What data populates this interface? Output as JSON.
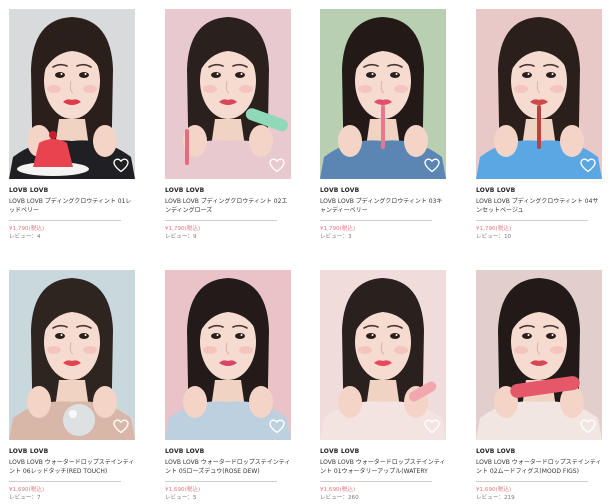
{
  "products": [
    {
      "brand": "LOVB LOVB",
      "name": "LOVB LOVB プディングクロウティント 01レッドベリー",
      "price": "¥1,790(税込)",
      "reviews": "レビュー：4",
      "bg": "#d9dadc",
      "lip": "#e03a4a",
      "hair": "#2b1f1c",
      "top": "#1f1f24",
      "prop": "jelly",
      "accent": "#e8434f"
    },
    {
      "brand": "LOVB LOVB",
      "name": "LOVB LOVB プディングクロウティント 02エンディングローズ",
      "price": "¥1,790(税込)",
      "reviews": "レビュー：9",
      "bg": "#e7c9cf",
      "lip": "#d8475c",
      "hair": "#2a201d",
      "top": "#e7c9cf",
      "prop": "tube-mint",
      "accent": "#8fd8b8"
    },
    {
      "brand": "LOVB LOVB",
      "name": "LOVB LOVB プディングクロウティント 03キャンディーベリー",
      "price": "¥1,790(税込)",
      "reviews": "レビュー：3",
      "bg": "#b9cfb1",
      "lip": "#e0506a",
      "hair": "#231a18",
      "top": "#5b86b4",
      "prop": "wand",
      "accent": "#e47a8d"
    },
    {
      "brand": "LOVB LOVB",
      "name": "LOVB LOVB プディングクロウティント 04サンセットベージュ",
      "price": "¥1,790(税込)",
      "reviews": "レビュー：10",
      "bg": "#e9c9c8",
      "lip": "#cc4a48",
      "hair": "#2b1f1c",
      "top": "#5aa7e4",
      "prop": "wand",
      "accent": "#c0403c"
    },
    {
      "brand": "LOVB LOVB",
      "name": "LOVB LOVB ウォータードロップステインティント 06レッドタッチ(RED TOUCH)",
      "price": "¥1,690(税込)",
      "reviews": "レビュー：7",
      "bg": "#c9d8dc",
      "lip": "#e2454f",
      "hair": "#2e2420",
      "top": "#d8b7a8",
      "prop": "orb",
      "accent": "#dfe6e8"
    },
    {
      "brand": "LOVB LOVB",
      "name": "LOVB LOVB ウォータードロップステインティント 05ローズデュウ(ROSE DEW)",
      "price": "¥1,690(税込)",
      "reviews": "レビュー：5",
      "bg": "#e9c3c8",
      "lip": "#d9456a",
      "hair": "#231b19",
      "top": "#bcd0df",
      "prop": "none",
      "accent": "#d9456a"
    },
    {
      "brand": "LOVB LOVB",
      "name": "LOVB LOVB ウォータードロップステインティント 01ウォータリーアップル(WATERY APPLE)",
      "price": "¥1,690(税込)",
      "reviews": "レビュー：260",
      "bg": "#f1dcdc",
      "lip": "#e8485a",
      "hair": "#2a201d",
      "top": "#f3e4e2",
      "prop": "tube-pink",
      "accent": "#f2a6ae"
    },
    {
      "brand": "LOVB LOVB",
      "name": "LOVB LOVB ウォータードロップステインティント 02ムードフィグス(MOOD FIGS)",
      "price": "¥1,690(税込)",
      "reviews": "レビュー：219",
      "bg": "#e2cfcc",
      "lip": "#d64756",
      "hair": "#221a18",
      "top": "#f1e6e2",
      "prop": "tube-red",
      "accent": "#e4586a"
    }
  ],
  "icons": {
    "favorite": "heart-outline-icon"
  }
}
